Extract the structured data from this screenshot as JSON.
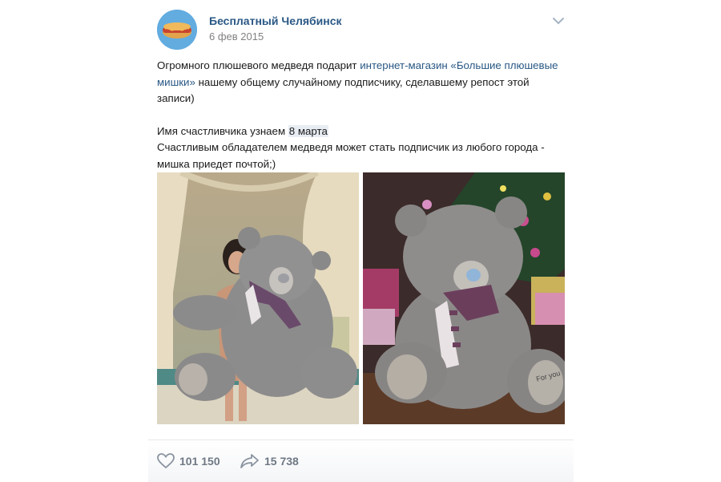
{
  "post": {
    "author": "Бесплатный Челябинск",
    "date": "6 фев 2015",
    "text": {
      "p1_part1": "Огромного плюшевого медведя подарит ",
      "p1_link": "интернет-магазин «Большие плюшевые мишки»",
      "p1_part2": " нашему общему случайному подписчику, сделавшему репост этой записи)",
      "p2_part1": "Имя счастливчика узнаем ",
      "p2_highlight": "8 марта",
      "p3": "Счастливым обладателем медведя может стать подписчик из любого города - мишка приедет почтой;)"
    },
    "bear2_tag_text": "For you",
    "actions": {
      "likes_count": "101 150",
      "shares_count": "15 738"
    }
  },
  "colors": {
    "link": "#2a5885",
    "meta": "#828282",
    "counter": "#6f7985"
  }
}
